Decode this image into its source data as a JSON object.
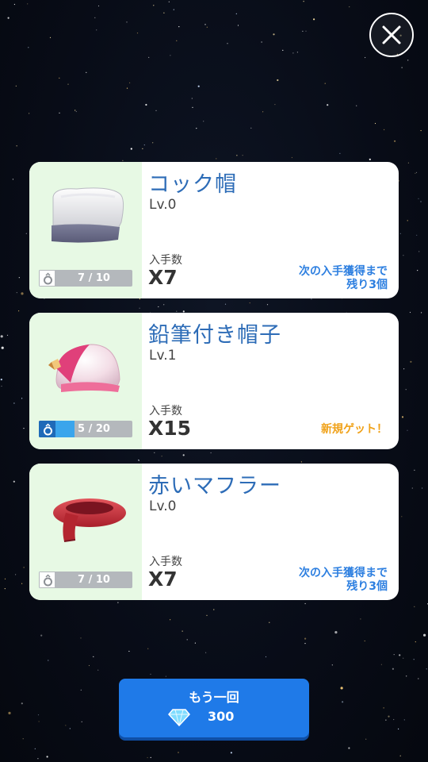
{
  "colors": {
    "accent_blue": "#2d6cb7",
    "note_blue": "#2d7fe0",
    "new_orange": "#f0a21a",
    "progress_fill": "#3aa5ec",
    "button_blue": "#1f7ae8",
    "thumb_bg": "#e7f9e4"
  },
  "close": {
    "icon": "close-icon"
  },
  "items": [
    {
      "name": "コック帽",
      "level": "Lv.0",
      "count_label": "入手数",
      "count": "X7",
      "progress_text": "7 / 10",
      "progress_filled": 0,
      "note_line1": "次の入手獲得まで",
      "note_line2": "残り3個",
      "icon": "chef-hat-icon"
    },
    {
      "name": "鉛筆付き帽子",
      "level": "Lv.1",
      "count_label": "入手数",
      "count": "X15",
      "progress_text": "5 / 20",
      "progress_filled": 0.25,
      "new_label": "新規ゲット！",
      "icon": "pencil-cap-icon"
    },
    {
      "name": "赤いマフラー",
      "level": "Lv.0",
      "count_label": "入手数",
      "count": "X7",
      "progress_text": "7 / 10",
      "progress_filled": 0,
      "note_line1": "次の入手獲得まで",
      "note_line2": "残り3個",
      "icon": "red-scarf-icon"
    }
  ],
  "retry": {
    "label": "もう一回",
    "cost": "300",
    "currency_icon": "diamond-icon"
  }
}
